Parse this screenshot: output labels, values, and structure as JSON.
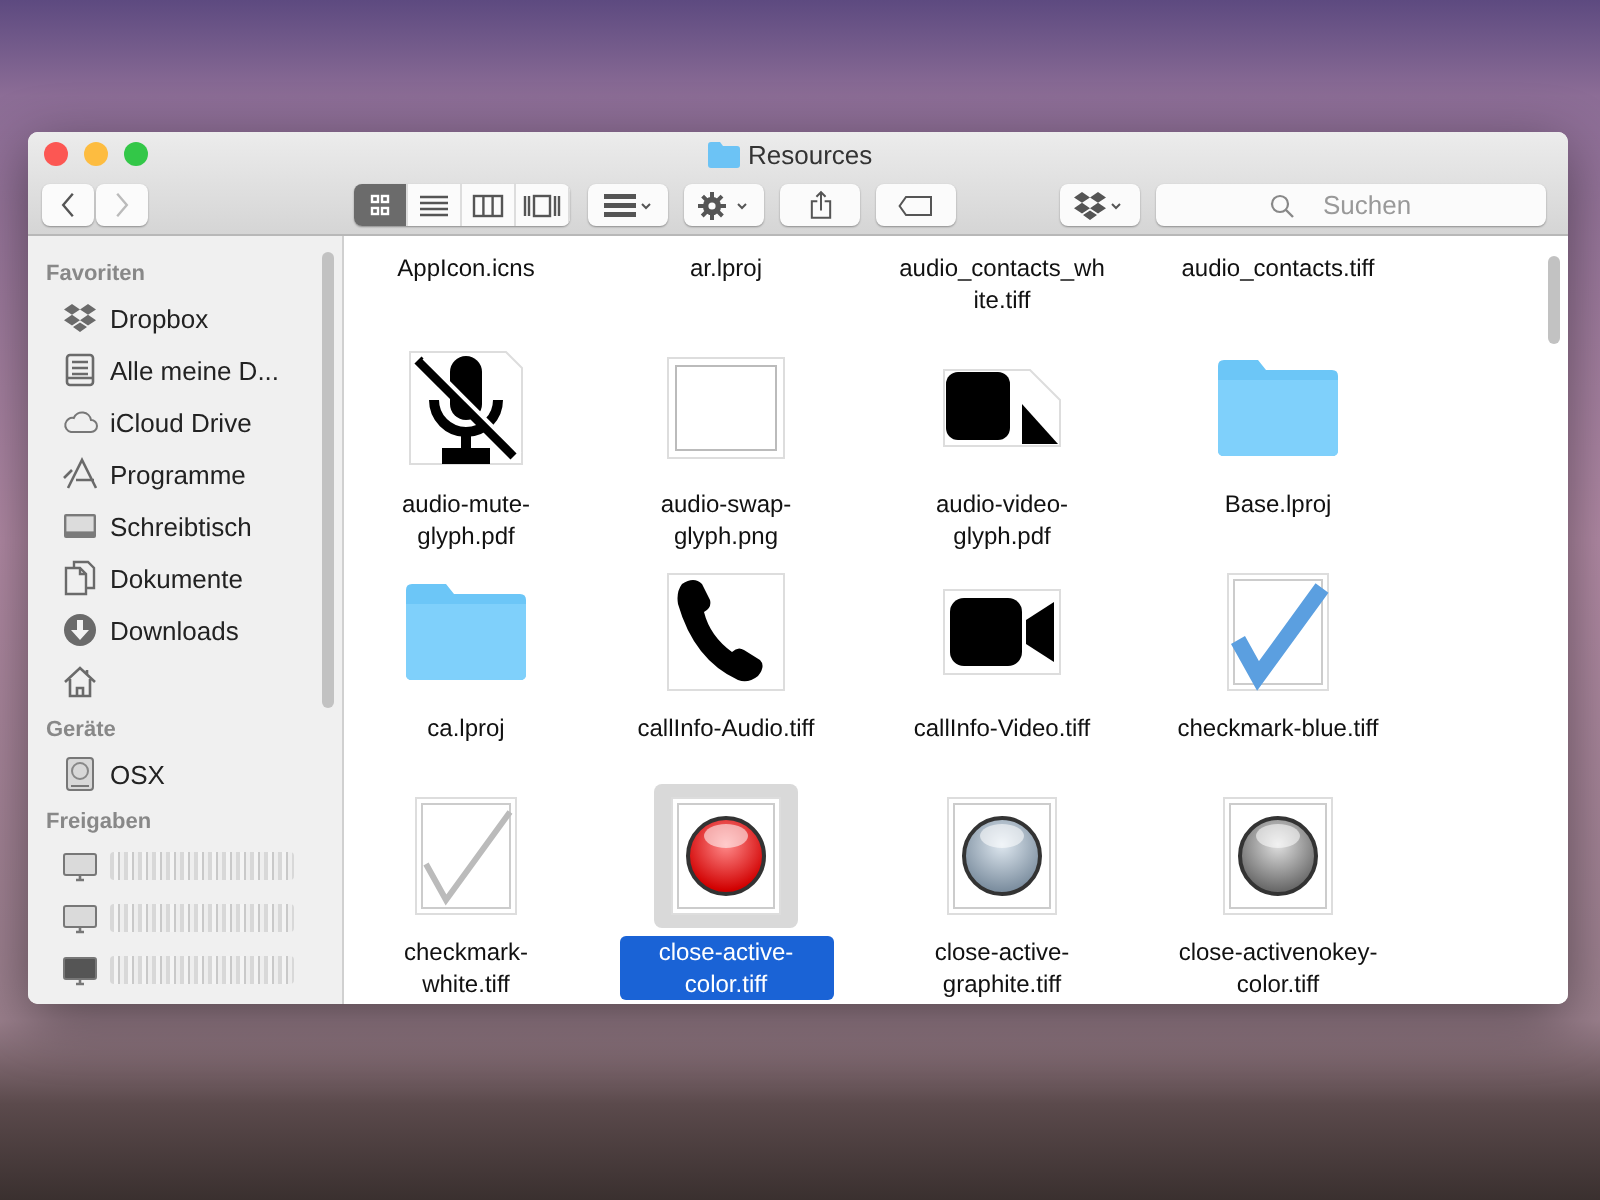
{
  "window": {
    "title": "Resources"
  },
  "toolbar": {
    "view_modes": [
      {
        "kind": "icons",
        "selected": true
      },
      {
        "kind": "list",
        "selected": false
      },
      {
        "kind": "columns",
        "selected": false
      },
      {
        "kind": "coverflow",
        "selected": false
      }
    ],
    "search": {
      "placeholder": "Suchen"
    }
  },
  "sidebar": {
    "sections": [
      {
        "title": "Favoriten",
        "items": [
          {
            "kind": "dropbox",
            "label": "Dropbox"
          },
          {
            "kind": "documents-all",
            "label": "Alle meine D..."
          },
          {
            "kind": "cloud",
            "label": "iCloud Drive"
          },
          {
            "kind": "apps",
            "label": "Programme"
          },
          {
            "kind": "desktop",
            "label": "Schreibtisch"
          },
          {
            "kind": "document",
            "label": "Dokumente"
          },
          {
            "kind": "download",
            "label": "Downloads"
          },
          {
            "kind": "home"
          }
        ]
      },
      {
        "title": "Geräte",
        "items": [
          {
            "kind": "disk",
            "label": "OSX"
          }
        ]
      },
      {
        "title": "Freigaben",
        "items": [
          {
            "kind": "display",
            "redacted": true
          },
          {
            "kind": "display",
            "redacted": true
          },
          {
            "kind": "display-dark",
            "redacted": true
          }
        ]
      }
    ]
  },
  "files": [
    {
      "name": "AppIcon.icns",
      "kind": "none",
      "selected": false
    },
    {
      "name": "ar.lproj",
      "kind": "none",
      "selected": false
    },
    {
      "name": "audio_contacts_white.tiff",
      "kind": "none",
      "selected": false
    },
    {
      "name": "audio_contacts.tiff",
      "kind": "none",
      "selected": false
    },
    {
      "name": "audio-mute-glyph.pdf",
      "kind": "mic-muted",
      "selected": false
    },
    {
      "name": "audio-swap-glyph.png",
      "kind": "blank",
      "selected": false
    },
    {
      "name": "audio-video-glyph.pdf",
      "kind": "video-pdf",
      "selected": false
    },
    {
      "name": "Base.lproj",
      "kind": "folder",
      "selected": false
    },
    {
      "name": "ca.lproj",
      "kind": "folder",
      "selected": false
    },
    {
      "name": "callInfo-Audio.tiff",
      "kind": "phone",
      "selected": false
    },
    {
      "name": "callInfo-Video.tiff",
      "kind": "camera",
      "selected": false
    },
    {
      "name": "checkmark-blue.tiff",
      "kind": "check-blue",
      "selected": false
    },
    {
      "name": "checkmark-white.tiff",
      "kind": "check-white",
      "selected": false
    },
    {
      "name": "close-active-color.tiff",
      "kind": "orb-red",
      "selected": true
    },
    {
      "name": "close-active-graphite.tiff",
      "kind": "orb-blue",
      "selected": false
    },
    {
      "name": "close-activenokey-color.tiff",
      "kind": "orb-grey",
      "selected": false
    }
  ]
}
